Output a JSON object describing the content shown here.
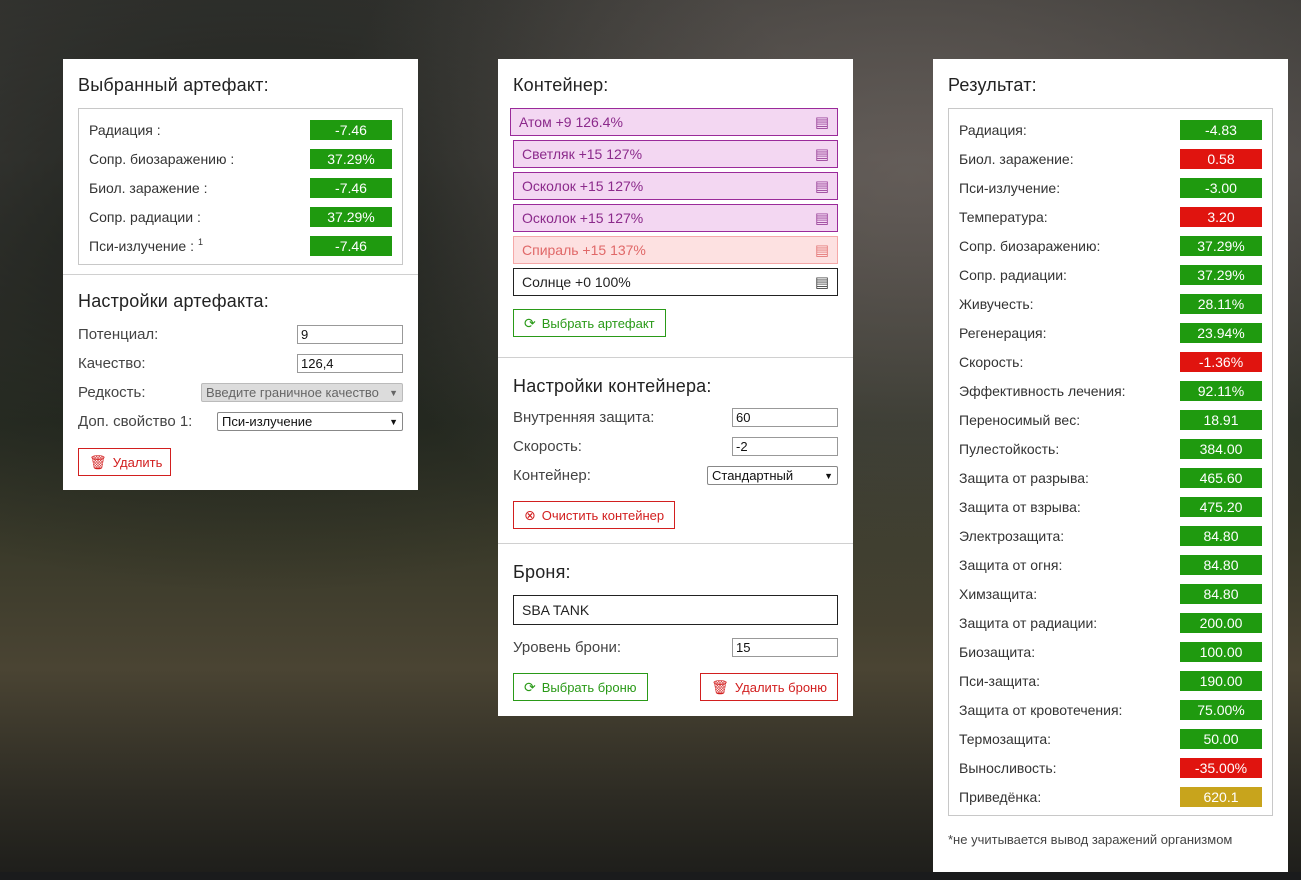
{
  "artifact_panel": {
    "title": "Выбранный артефакт:",
    "stats": [
      {
        "label": "Радиация :",
        "value": "-7.46",
        "color": "green"
      },
      {
        "label": "Сопр. биозаражению :",
        "value": "37.29%",
        "color": "green"
      },
      {
        "label": "Биол. заражение :",
        "value": "-7.46",
        "color": "green"
      },
      {
        "label": "Сопр. радиации :",
        "value": "37.29%",
        "color": "green"
      },
      {
        "label": "Пси-излучение :",
        "footnote": "1",
        "value": "-7.46",
        "color": "green"
      }
    ],
    "settings_title": "Настройки артефакта:",
    "potential_label": "Потенциал:",
    "potential_value": "9",
    "quality_label": "Качество:",
    "quality_value": "126,4",
    "rarity_label": "Редкость:",
    "rarity_selected": "Введите граничное качество",
    "extra_prop_label": "Доп. свойство 1:",
    "extra_prop_selected": "Пси-излучение",
    "delete_label": "Удалить"
  },
  "container_panel": {
    "title": "Контейнер:",
    "slots": [
      {
        "label": "Атом +9 126.4%",
        "style": "purple"
      },
      {
        "label": "Светляк +15 127%",
        "style": "purple"
      },
      {
        "label": "Осколок +15 127%",
        "style": "purple"
      },
      {
        "label": "Осколок +15 127%",
        "style": "purple"
      },
      {
        "label": "Спираль +15 137%",
        "style": "pink"
      },
      {
        "label": "Солнце +0 100%",
        "style": "plain"
      }
    ],
    "choose_artifact_label": "Выбрать артефакт",
    "settings_title": "Настройки контейнера:",
    "inner_protection_label": "Внутренняя защита:",
    "inner_protection_value": "60",
    "speed_label": "Скорость:",
    "speed_value": "-2",
    "container_label": "Контейнер:",
    "container_selected": "Стандартный",
    "clear_label": "Очистить контейнер",
    "armor_title": "Броня:",
    "armor_name": "SBA TANK",
    "armor_level_label": "Уровень брони:",
    "armor_level_value": "15",
    "choose_armor_label": "Выбрать броню",
    "delete_armor_label": "Удалить броню"
  },
  "result_panel": {
    "title": "Результат:",
    "stats": [
      {
        "label": "Радиация:",
        "value": "-4.83",
        "color": "green"
      },
      {
        "label": "Биол. заражение:",
        "value": "0.58",
        "color": "red"
      },
      {
        "label": "Пси-излучение:",
        "value": "-3.00",
        "color": "green"
      },
      {
        "label": "Температура:",
        "value": "3.20",
        "color": "red"
      },
      {
        "label": "Сопр. биозаражению:",
        "value": "37.29%",
        "color": "green"
      },
      {
        "label": "Сопр. радиации:",
        "value": "37.29%",
        "color": "green"
      },
      {
        "label": "Живучесть:",
        "value": "28.11%",
        "color": "green"
      },
      {
        "label": "Регенерация:",
        "value": "23.94%",
        "color": "green"
      },
      {
        "label": "Скорость:",
        "value": "-1.36%",
        "color": "red"
      },
      {
        "label": "Эффективность лечения:",
        "value": "92.11%",
        "color": "green"
      },
      {
        "label": "Переносимый вес:",
        "value": "18.91",
        "color": "green"
      },
      {
        "label": "Пулестойкость:",
        "value": "384.00",
        "color": "green"
      },
      {
        "label": "Защита от разрыва:",
        "value": "465.60",
        "color": "green"
      },
      {
        "label": "Защита от взрыва:",
        "value": "475.20",
        "color": "green"
      },
      {
        "label": "Электрозащита:",
        "value": "84.80",
        "color": "green"
      },
      {
        "label": "Защита от огня:",
        "value": "84.80",
        "color": "green"
      },
      {
        "label": "Химзащита:",
        "value": "84.80",
        "color": "green"
      },
      {
        "label": "Защита от радиации:",
        "value": "200.00",
        "color": "green"
      },
      {
        "label": "Биозащита:",
        "value": "100.00",
        "color": "green"
      },
      {
        "label": "Пси-защита:",
        "value": "190.00",
        "color": "green"
      },
      {
        "label": "Защита от кровотечения:",
        "value": "75.00%",
        "color": "green"
      },
      {
        "label": "Термозащита:",
        "value": "50.00",
        "color": "green"
      },
      {
        "label": "Выносливость:",
        "value": "-35.00%",
        "color": "red"
      },
      {
        "label": "Приведёнка:",
        "value": "620.1",
        "color": "yellow"
      }
    ],
    "note": "*не учитывается вывод заражений организмом"
  }
}
